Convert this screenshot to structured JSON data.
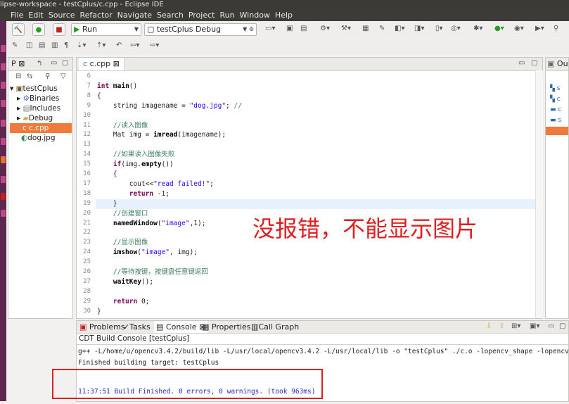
{
  "window": {
    "title": "lipse-workspace - testCplus/c.cpp - Eclipse IDE"
  },
  "menu": [
    "File",
    "Edit",
    "Source",
    "Refactor",
    "Navigate",
    "Search",
    "Project",
    "Run",
    "Window",
    "Help"
  ],
  "toolbar": {
    "run_config": "Run",
    "build_target": "testCplus Debug"
  },
  "project_explorer": {
    "tab_label": "P",
    "tree": [
      {
        "label": "testCplus",
        "level": 0,
        "icon": "project-icon",
        "expanded": true
      },
      {
        "label": "Binaries",
        "level": 1,
        "icon": "binaries-icon",
        "expanded": false
      },
      {
        "label": "Includes",
        "level": 1,
        "icon": "includes-icon",
        "expanded": false
      },
      {
        "label": "Debug",
        "level": 1,
        "icon": "folder-icon",
        "expanded": false
      },
      {
        "label": "c.cpp",
        "level": 1,
        "icon": "cpp-file-icon",
        "selected": true
      },
      {
        "label": "dog.jpg",
        "level": 1,
        "icon": "image-file-icon"
      }
    ]
  },
  "editor": {
    "tab_label": "c.cpp",
    "lines": [
      {
        "n": "6",
        "code": ""
      },
      {
        "n": "7",
        "code": "int main()"
      },
      {
        "n": "8",
        "code": "{"
      },
      {
        "n": "9",
        "code": "    string imagename = \"dog.jpg\"; //"
      },
      {
        "n": "10",
        "code": ""
      },
      {
        "n": "11",
        "code": "    //读入图像"
      },
      {
        "n": "12",
        "code": "    Mat img = imread(imagename);"
      },
      {
        "n": "13",
        "code": ""
      },
      {
        "n": "14",
        "code": "    //如果读入图像失败"
      },
      {
        "n": "15",
        "code": "    if(img.empty())"
      },
      {
        "n": "16",
        "code": "    {"
      },
      {
        "n": "17",
        "code": "        cout<<\"read failed!\";"
      },
      {
        "n": "18",
        "code": "        return -1;"
      },
      {
        "n": "19",
        "code": "    }"
      },
      {
        "n": "20",
        "code": "    //创建窗口"
      },
      {
        "n": "21",
        "code": "    namedWindow(\"image\",1);"
      },
      {
        "n": "22",
        "code": ""
      },
      {
        "n": "23",
        "code": "    //显示图像"
      },
      {
        "n": "24",
        "code": "    imshow(\"image\", img);"
      },
      {
        "n": "25",
        "code": ""
      },
      {
        "n": "26",
        "code": "    //等待按键，按键盘任意键返回"
      },
      {
        "n": "27",
        "code": "    waitKey();"
      },
      {
        "n": "28",
        "code": ""
      },
      {
        "n": "29",
        "code": "    return 0;"
      },
      {
        "n": "30",
        "code": "}"
      }
    ],
    "annotation": "没报错，不能显示图片",
    "annotation_color": "#e02020"
  },
  "outline": {
    "tab_label": "Ou"
  },
  "bottom_panel": {
    "tabs": [
      "Problems",
      "Tasks",
      "Console",
      "Properties",
      "Call Graph"
    ],
    "active_tab": "Console",
    "console_title": "CDT Build Console [testCplus]",
    "lines": [
      "g++ -L/home/u/opencv3.4.2/build/lib -L/usr/local/opencv3.4.2 -L/usr/local/lib -o \"testCplus\"  ./c.o   -lopencv_shape -lopencv_objdet",
      "Finished building target: testCplus"
    ],
    "finished_line": "11:37:51 Build Finished. 0 errors, 0 warnings. (took 963ms)",
    "highlight_color": "#e02020"
  }
}
